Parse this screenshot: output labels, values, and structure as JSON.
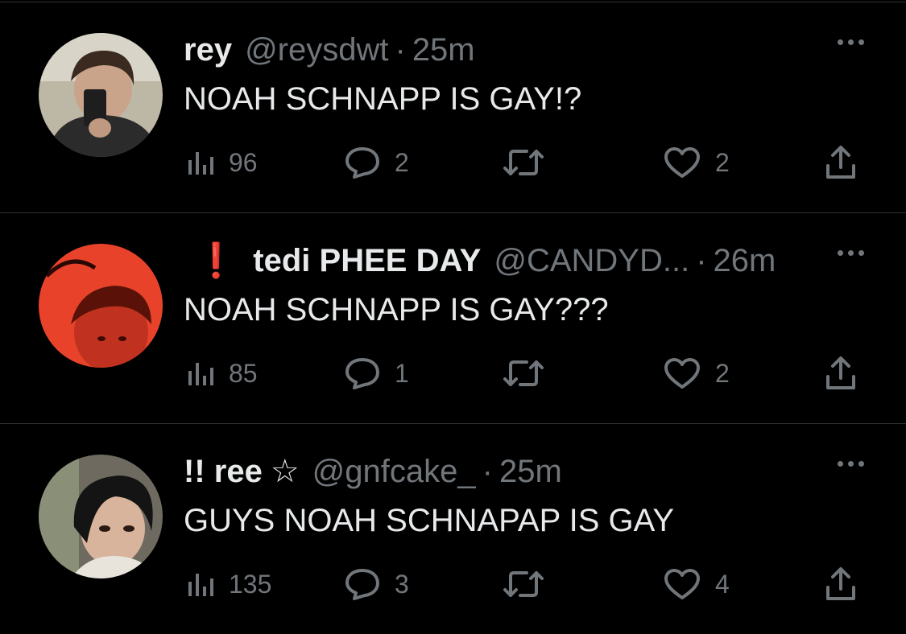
{
  "tweets": [
    {
      "name": "rey",
      "alert": "",
      "star": "",
      "handle": "@reysdwt",
      "time": "25m",
      "text": "NOAH SCHNAPP IS GAY!?",
      "views": "96",
      "replies": "2",
      "likes": "2"
    },
    {
      "name": "tedi PHEE DAY",
      "alert": "❗",
      "star": "",
      "handle": "@CANDYD...",
      "time": "26m",
      "text": "NOAH SCHNAPP IS GAY???",
      "views": "85",
      "replies": "1",
      "likes": "2"
    },
    {
      "name": "!! ree",
      "alert": "",
      "star": "☆",
      "handle": "@gnfcake_",
      "time": "25m",
      "text": "GUYS NOAH SCHNAPAP IS GAY",
      "views": "135",
      "replies": "3",
      "likes": "4"
    }
  ],
  "separator": "·",
  "icons": {
    "views": "views-icon",
    "reply": "reply-icon",
    "retweet": "retweet-icon",
    "like": "like-icon",
    "share": "share-icon",
    "more": "more-icon"
  },
  "colors": {
    "background": "#000000",
    "text": "#e7e9ea",
    "muted": "#71767b",
    "divider": "#2f3336",
    "alert": "#f4212e"
  }
}
